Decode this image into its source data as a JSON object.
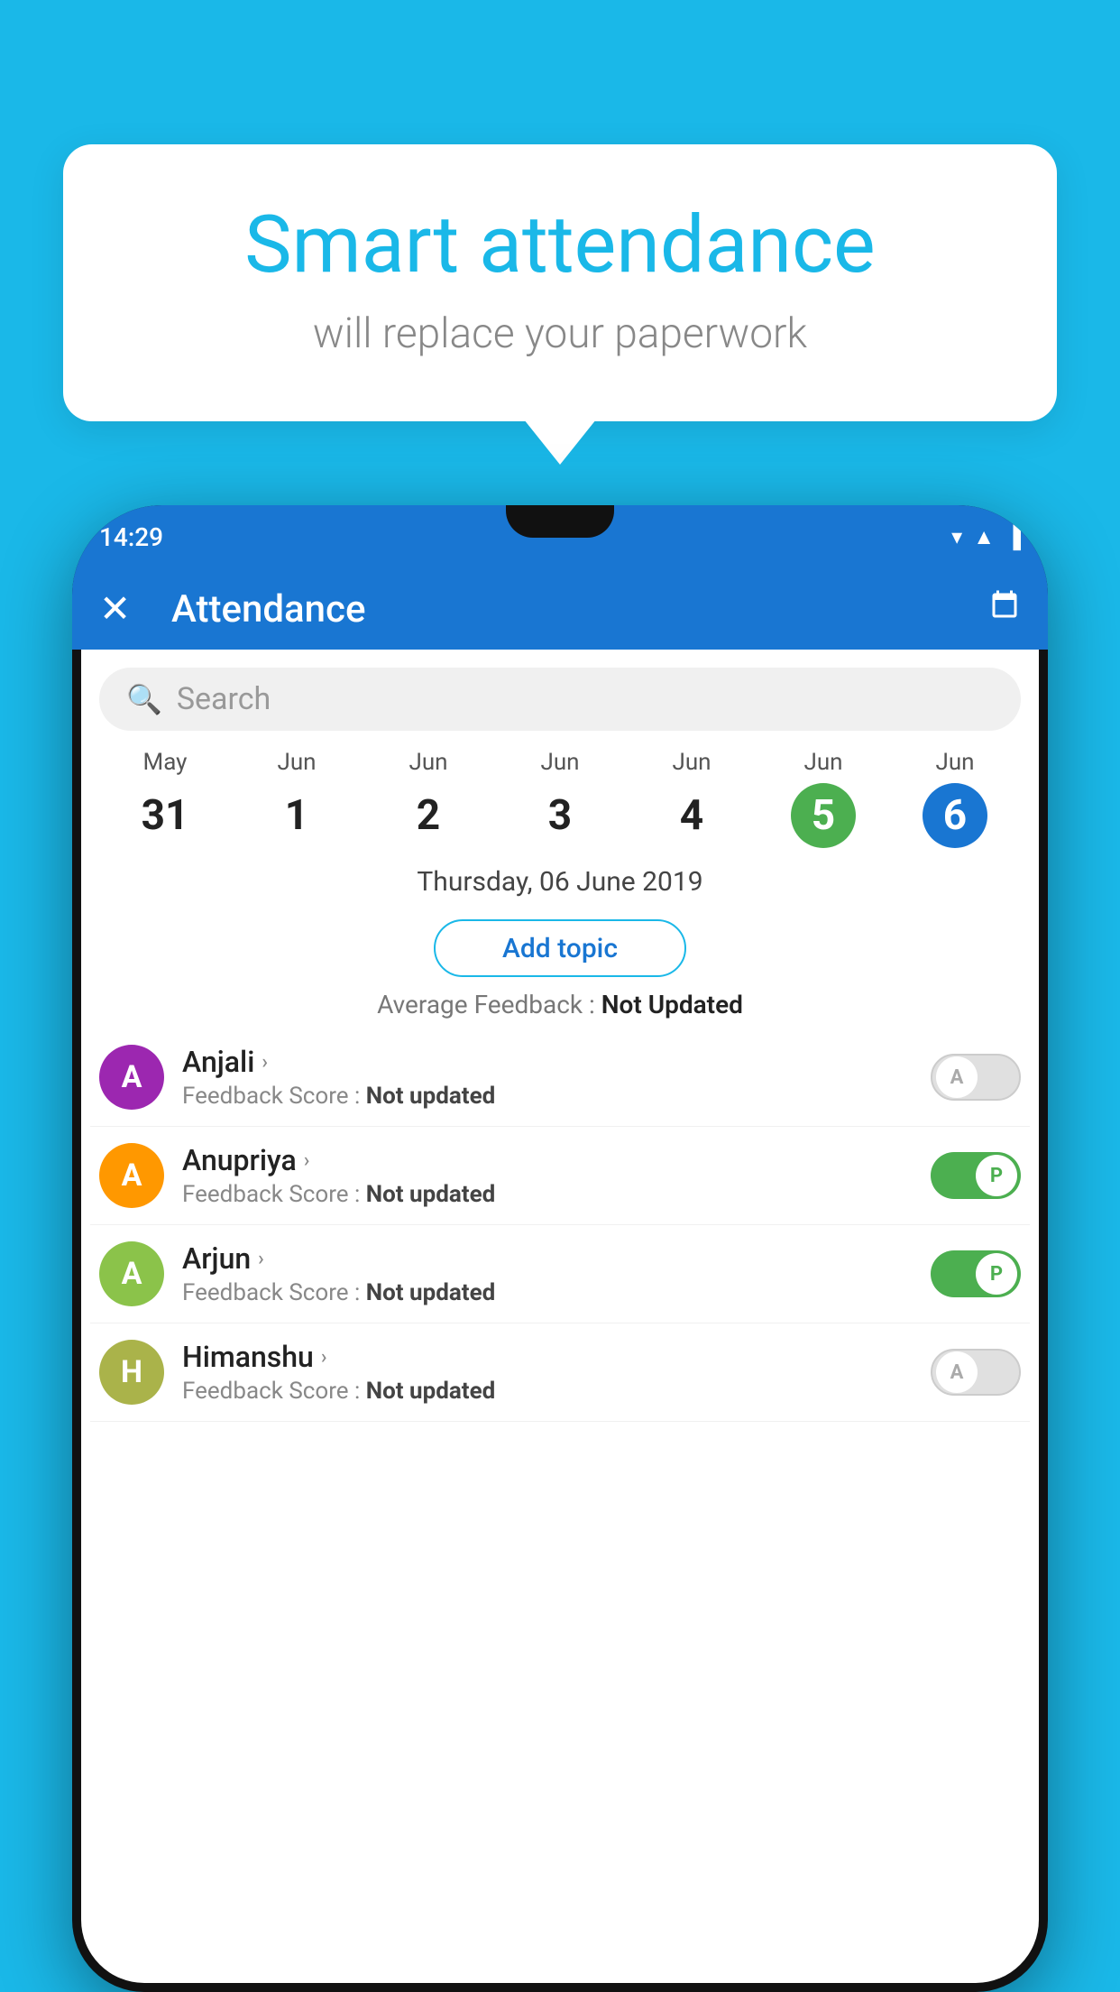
{
  "background_color": "#1ab8e8",
  "speech_bubble": {
    "title": "Smart attendance",
    "subtitle": "will replace your paperwork"
  },
  "status_bar": {
    "time": "14:29",
    "icons": [
      "wifi",
      "signal",
      "battery"
    ]
  },
  "app_header": {
    "close_label": "✕",
    "title": "Attendance",
    "calendar_icon": "📅"
  },
  "search": {
    "placeholder": "Search"
  },
  "dates": [
    {
      "month": "May",
      "day": "31",
      "state": "normal"
    },
    {
      "month": "Jun",
      "day": "1",
      "state": "normal"
    },
    {
      "month": "Jun",
      "day": "2",
      "state": "normal"
    },
    {
      "month": "Jun",
      "day": "3",
      "state": "normal"
    },
    {
      "month": "Jun",
      "day": "4",
      "state": "normal"
    },
    {
      "month": "Jun",
      "day": "5",
      "state": "today"
    },
    {
      "month": "Jun",
      "day": "6",
      "state": "selected"
    }
  ],
  "selected_date_label": "Thursday, 06 June 2019",
  "add_topic_label": "Add topic",
  "avg_feedback_label": "Average Feedback : ",
  "avg_feedback_value": "Not Updated",
  "students": [
    {
      "name": "Anjali",
      "initial": "A",
      "avatar_color": "#9c27b0",
      "feedback_label": "Feedback Score : ",
      "feedback_value": "Not updated",
      "toggle_state": "off",
      "toggle_label": "A"
    },
    {
      "name": "Anupriya",
      "initial": "A",
      "avatar_color": "#ff9800",
      "feedback_label": "Feedback Score : ",
      "feedback_value": "Not updated",
      "toggle_state": "on",
      "toggle_label": "P"
    },
    {
      "name": "Arjun",
      "initial": "A",
      "avatar_color": "#8bc34a",
      "feedback_label": "Feedback Score : ",
      "feedback_value": "Not updated",
      "toggle_state": "on",
      "toggle_label": "P"
    },
    {
      "name": "Himanshu",
      "initial": "H",
      "avatar_color": "#aab34a",
      "feedback_label": "Feedback Score : ",
      "feedback_value": "Not updated",
      "toggle_state": "off",
      "toggle_label": "A"
    }
  ]
}
